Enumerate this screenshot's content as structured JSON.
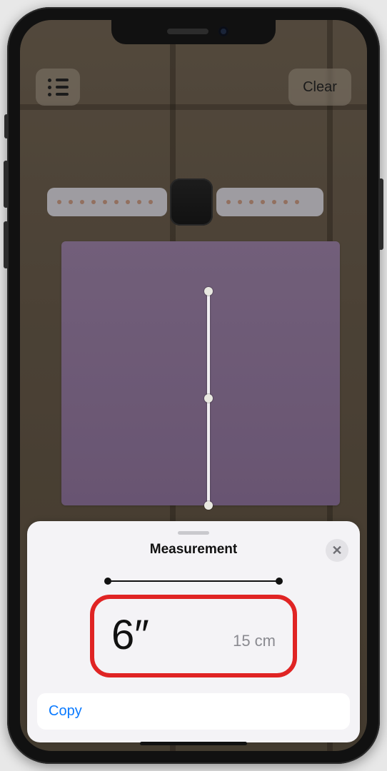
{
  "toolbar": {
    "clear_label": "Clear"
  },
  "sheet": {
    "title": "Measurement",
    "primary_value": "6″",
    "secondary_value": "15 cm",
    "copy_label": "Copy"
  }
}
